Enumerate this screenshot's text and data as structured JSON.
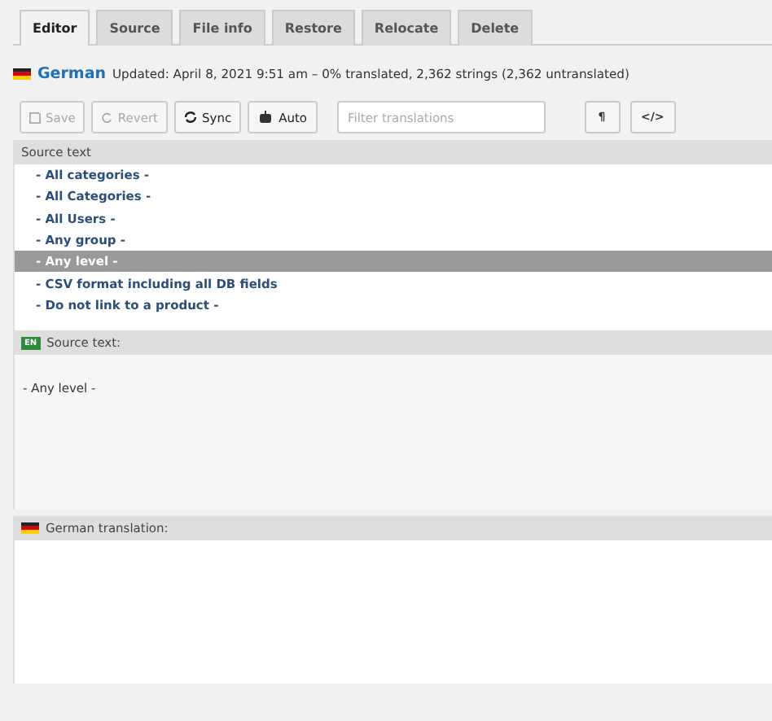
{
  "tabs": [
    {
      "label": "Editor",
      "selected": true
    },
    {
      "label": "Source",
      "selected": false
    },
    {
      "label": "File info",
      "selected": false
    },
    {
      "label": "Restore",
      "selected": false
    },
    {
      "label": "Relocate",
      "selected": false
    },
    {
      "label": "Delete",
      "selected": false
    }
  ],
  "status": {
    "language": "German",
    "summary": "Updated: April 8, 2021 9:51 am – 0% translated, 2,362 strings (2,362 untranslated)"
  },
  "toolbar": {
    "buttons": [
      {
        "label": "Save",
        "kind": "save",
        "disabled": true
      },
      {
        "label": "Revert",
        "kind": "revert",
        "disabled": true
      },
      {
        "label": "Sync",
        "kind": "sync",
        "disabled": false
      },
      {
        "label": "Auto",
        "kind": "auto",
        "disabled": false
      }
    ],
    "filter": {
      "placeholder": "Filter translations"
    },
    "toggles": [
      {
        "label": "¶"
      },
      {
        "label": "</>"
      }
    ]
  },
  "list": {
    "header": "Source text",
    "rows": [
      {
        "text": "- All categories -",
        "selected": false
      },
      {
        "text": "- All Categories -",
        "selected": false
      },
      {
        "text": "- All Users -",
        "selected": false
      },
      {
        "text": "- Any group -",
        "selected": false
      },
      {
        "text": "- Any level -",
        "selected": true
      },
      {
        "text": "- CSV format including all DB fields",
        "selected": false
      },
      {
        "text": "- Do not link to a product -",
        "selected": false
      }
    ]
  },
  "source_panel": {
    "badge": "EN",
    "label": "Source text:",
    "text": "- Any level -"
  },
  "translation_panel": {
    "label": "German translation:"
  }
}
